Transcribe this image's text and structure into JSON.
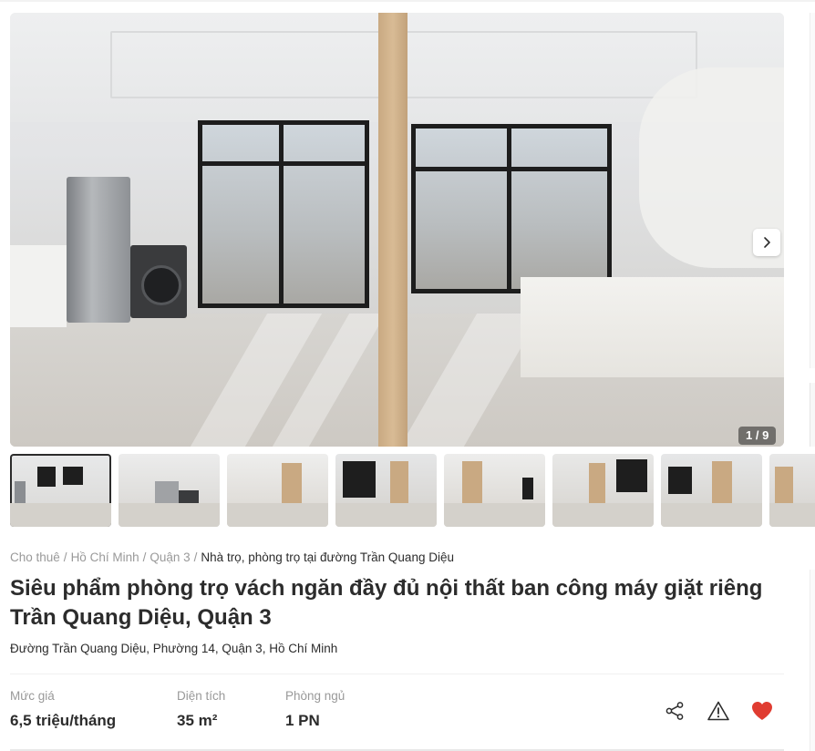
{
  "gallery": {
    "counter": "1 / 9",
    "next_icon": "chevron-right-icon",
    "thumbnail_count": 8
  },
  "breadcrumb": {
    "items": [
      "Cho thuê",
      "Hồ Chí Minh",
      "Quận 3"
    ],
    "current": "Nhà trọ, phòng trọ tại đường Trần Quang Diệu"
  },
  "listing": {
    "title": "Siêu phẩm phòng trọ vách ngăn đầy đủ nội thất ban công máy giặt riêng Trần Quang Diệu, Quận 3",
    "address": "Đường Trần Quang Diệu, Phường 14, Quận 3, Hồ Chí Minh"
  },
  "stats": {
    "price_label": "Mức giá",
    "price_value": "6,5 triệu/tháng",
    "area_label": "Diện tích",
    "area_value": "35 m²",
    "bedrooms_label": "Phòng ngủ",
    "bedrooms_value": "1 PN"
  },
  "actions": {
    "share_icon": "share-icon",
    "report_icon": "warning-icon",
    "favorite_icon": "heart-icon"
  },
  "colors": {
    "favorite": "#e03c31",
    "text": "#2c2c2c",
    "muted": "#999999"
  }
}
